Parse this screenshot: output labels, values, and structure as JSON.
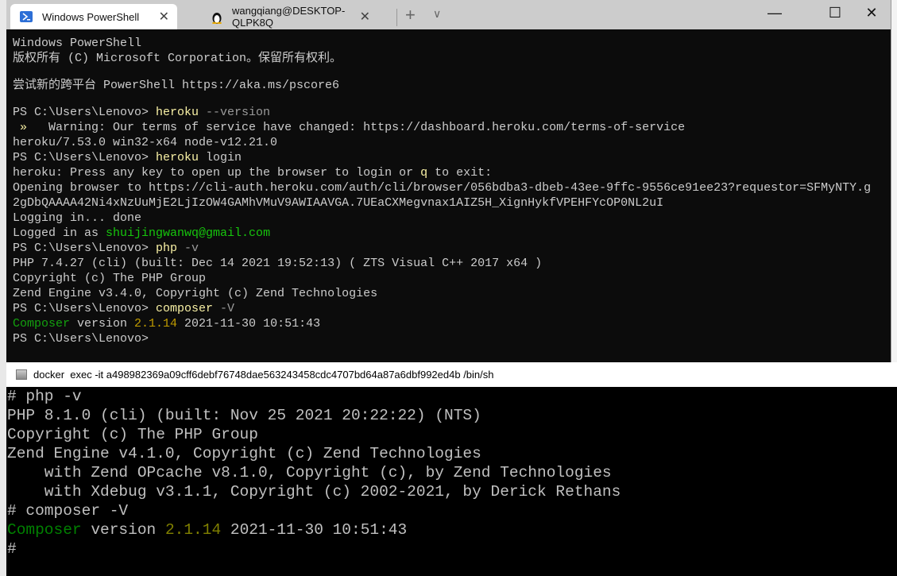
{
  "terminal": {
    "tabs": [
      {
        "label": "Windows PowerShell",
        "icon": "powershell-icon"
      },
      {
        "label": "wangqiang@DESKTOP-QLPK8Q",
        "icon": "linux-penguin-icon"
      }
    ],
    "colors": {
      "default": "#cccccc",
      "cmd": "#f9f1a5",
      "arg": "#9a9a9a",
      "warn": "#f9f1a5",
      "email": "#16c60c",
      "green": "#13a10e",
      "version": "#c19c00"
    },
    "lines": [
      [
        [
          "default",
          "Windows PowerShell"
        ]
      ],
      [
        [
          "default",
          "版权所有 (C) Microsoft Corporation。保留所有权利。"
        ]
      ],
      [
        [
          "default",
          ""
        ]
      ],
      [
        [
          "default",
          "尝试新的跨平台 PowerShell https://aka.ms/pscore6"
        ]
      ],
      [
        [
          "default",
          ""
        ]
      ],
      [
        [
          "default",
          "PS C:\\Users\\Lenovo> "
        ],
        [
          "cmd",
          "heroku"
        ],
        [
          "arg",
          " --version"
        ]
      ],
      [
        [
          "warn",
          " »"
        ],
        [
          "default",
          "   Warning: Our terms of service have changed: https://dashboard.heroku.com/terms-of-service"
        ]
      ],
      [
        [
          "default",
          "heroku/7.53.0 win32-x64 node-v12.21.0"
        ]
      ],
      [
        [
          "default",
          "PS C:\\Users\\Lenovo> "
        ],
        [
          "cmd",
          "heroku"
        ],
        [
          "default",
          " login"
        ]
      ],
      [
        [
          "default",
          "heroku: Press any key to open up the browser to login or "
        ],
        [
          "cmd",
          "q"
        ],
        [
          "default",
          " to exit:"
        ]
      ],
      [
        [
          "default",
          "Opening browser to https://cli-auth.heroku.com/auth/cli/browser/056bdba3-dbeb-43ee-9ffc-9556ce91ee23?requestor=SFMyNTY.g"
        ]
      ],
      [
        [
          "default",
          "2gDbQAAAA42Ni4xNzUuMjE2LjIzOW4GAMhVMuV9AWIAAVGA.7UEaCXMegvnax1AIZ5H_XignHykfVPEHFYcOP0NL2uI"
        ]
      ],
      [
        [
          "default",
          "Logging in... done"
        ]
      ],
      [
        [
          "default",
          "Logged in as "
        ],
        [
          "email",
          "shuijingwanwq@gmail.com"
        ]
      ],
      [
        [
          "default",
          "PS C:\\Users\\Lenovo> "
        ],
        [
          "cmd",
          "php"
        ],
        [
          "arg",
          " -v"
        ]
      ],
      [
        [
          "default",
          "PHP 7.4.27 (cli) (built: Dec 14 2021 19:52:13) ( ZTS Visual C++ 2017 x64 )"
        ]
      ],
      [
        [
          "default",
          "Copyright (c) The PHP Group"
        ]
      ],
      [
        [
          "default",
          "Zend Engine v3.4.0, Copyright (c) Zend Technologies"
        ]
      ],
      [
        [
          "default",
          "PS C:\\Users\\Lenovo> "
        ],
        [
          "cmd",
          "composer"
        ],
        [
          "arg",
          " -V"
        ]
      ],
      [
        [
          "green",
          "Composer"
        ],
        [
          "default",
          " version "
        ],
        [
          "version",
          "2.1.14"
        ],
        [
          "default",
          " 2021-11-30 10:51:43"
        ]
      ],
      [
        [
          "default",
          "PS C:\\Users\\Lenovo>"
        ]
      ]
    ]
  },
  "console": {
    "title": "docker  exec -it a498982369a09cff6debf76748dae563243458cdc4707bd64a87a6dbf992ed4b /bin/sh",
    "colors": {
      "default": "#c0c0c0",
      "green": "#008000",
      "version": "#808000"
    },
    "lines": [
      [
        [
          "default",
          "# php -v"
        ]
      ],
      [
        [
          "default",
          "PHP 8.1.0 (cli) (built: Nov 25 2021 20:22:22) (NTS)"
        ]
      ],
      [
        [
          "default",
          "Copyright (c) The PHP Group"
        ]
      ],
      [
        [
          "default",
          "Zend Engine v4.1.0, Copyright (c) Zend Technologies"
        ]
      ],
      [
        [
          "default",
          "    with Zend OPcache v8.1.0, Copyright (c), by Zend Technologies"
        ]
      ],
      [
        [
          "default",
          "    with Xdebug v3.1.1, Copyright (c) 2002-2021, by Derick Rethans"
        ]
      ],
      [
        [
          "default",
          "# composer -V"
        ]
      ],
      [
        [
          "green",
          "Composer"
        ],
        [
          "default",
          " version "
        ],
        [
          "version",
          "2.1.14"
        ],
        [
          "default",
          " 2021-11-30 10:51:43"
        ]
      ],
      [
        [
          "default",
          "#"
        ]
      ]
    ]
  }
}
